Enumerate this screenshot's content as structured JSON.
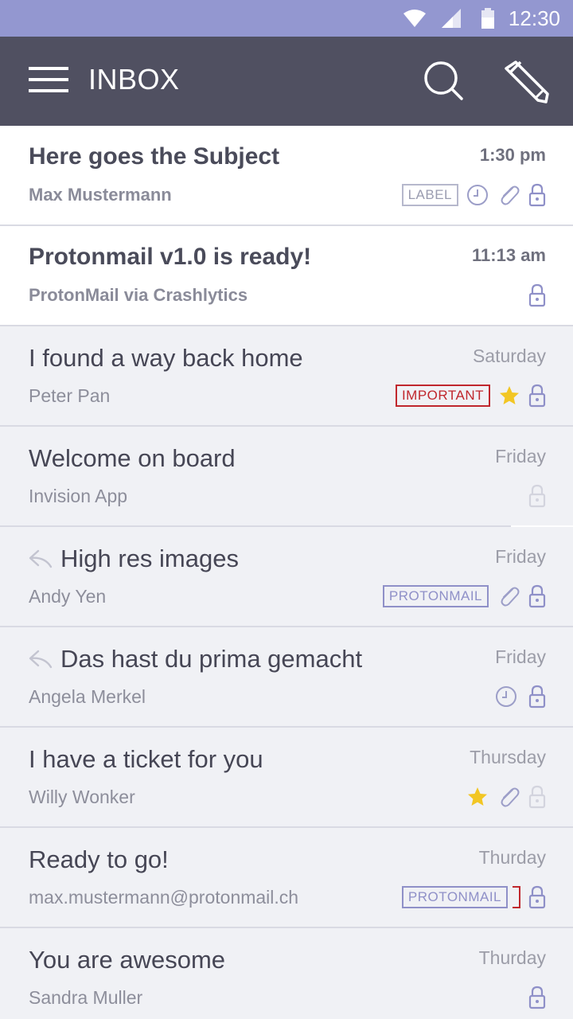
{
  "status_bar": {
    "time": "12:30",
    "icons": [
      "wifi-icon",
      "signal-icon",
      "battery-icon"
    ]
  },
  "app_bar": {
    "title": "INBOX",
    "icons": [
      "menu-icon",
      "search-icon",
      "compose-icon"
    ]
  },
  "colors": {
    "status_bar_bg": "#9397d0",
    "app_bar_bg": "#505061",
    "accent": "#8f90c8",
    "important": "#c0272d",
    "star": "#f2c624",
    "read_bg": "#f0f1f5",
    "unread_bg": "#ffffff"
  },
  "messages": [
    {
      "subject": "Here goes the Subject",
      "sender": "Max Mustermann",
      "time": "1:30 pm",
      "unread": true,
      "label": "LABEL",
      "icons": [
        "clock-icon",
        "paperclip-icon",
        "lock-icon"
      ]
    },
    {
      "subject": "Protonmail v1.0 is ready!",
      "sender": "ProtonMail via Crashlytics",
      "time": "11:13 am",
      "unread": true,
      "icons": [
        "lock-icon"
      ]
    },
    {
      "subject": "I found a way back home",
      "sender": "Peter Pan",
      "time": "Saturday",
      "unread": false,
      "label": "IMPORTANT",
      "icons": [
        "star-icon",
        "lock-icon"
      ]
    },
    {
      "subject": "Welcome on board",
      "sender": "Invision App",
      "time": "Friday",
      "unread": false,
      "icons": [
        "lock-open-icon"
      ]
    },
    {
      "subject": "High res images",
      "sender": "Andy Yen",
      "time": "Friday",
      "unread": false,
      "replied": true,
      "label": "PROTONMAIL",
      "icons": [
        "paperclip-icon",
        "lock-icon"
      ]
    },
    {
      "subject": "Das hast du prima gemacht",
      "sender": "Angela Merkel",
      "time": "Friday",
      "unread": false,
      "replied": true,
      "icons": [
        "clock-icon",
        "lock-icon"
      ]
    },
    {
      "subject": "I have a ticket for you",
      "sender": "Willy Wonker",
      "time": "Thursday",
      "unread": false,
      "icons": [
        "star-icon",
        "paperclip-icon",
        "lock-open-icon"
      ]
    },
    {
      "subject": "Ready to go!",
      "sender": "max.mustermann@protonmail.ch",
      "time": "Thurday",
      "unread": false,
      "label": "PROTONMAIL",
      "icons": [
        "lock-icon"
      ]
    },
    {
      "subject": "You are awesome",
      "sender": "Sandra Muller",
      "time": "Thurday",
      "unread": false,
      "icons": [
        "lock-icon"
      ]
    }
  ]
}
